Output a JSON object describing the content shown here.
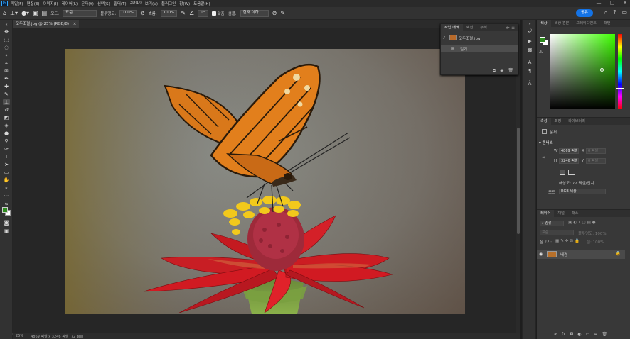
{
  "menubar": {
    "logo": "Ps",
    "items": [
      "파일(F)",
      "편집(E)",
      "이미지(I)",
      "레이어(L)",
      "문자(Y)",
      "선택(S)",
      "필터(T)",
      "3D(D)",
      "보기(V)",
      "플러그인",
      "창(W)",
      "도움말(H)"
    ],
    "controls": [
      "—",
      "▢",
      "✕"
    ]
  },
  "options": {
    "mode_label": "모드:",
    "mode_value": "표준",
    "opacity_label": "불투명도:",
    "opacity_value": "100%",
    "flow_label": "흐름:",
    "flow_value": "100%",
    "angle_value": "0°",
    "smooth_label": "맞춤",
    "sample_label": "샘플:",
    "sample_value": "현재 이하",
    "share": "공유"
  },
  "document": {
    "tab": "모두조절.jpg @ 25% (RGB/8)",
    "close": "×"
  },
  "status": {
    "zoom": "25%",
    "info": "4869 픽셀 x 3246 픽셀 (72 ppi)"
  },
  "history": {
    "tabs": [
      "작업 내역",
      "액션",
      "주석"
    ],
    "source": "모두조절.jpg",
    "step": "열기"
  },
  "color": {
    "tabs": [
      "색상",
      "색상 견본",
      "그레이디언트",
      "패턴"
    ],
    "fg": "#2e8b1e",
    "bg": "#ffffff"
  },
  "properties": {
    "tabs": [
      "속성",
      "조정",
      "라이브러리"
    ],
    "kind": "문서",
    "section": "캔버스",
    "w_label": "W",
    "w_value": "4869 픽셀",
    "h_label": "H",
    "h_value": "3246 픽셀",
    "x_label": "X",
    "y_label": "Y",
    "x_placeholder": "0 픽셀",
    "y_placeholder": "0 픽셀",
    "resolution": "해상도: 72 픽셀/인치",
    "mode_label": "모드",
    "mode_value": "RGB 색상"
  },
  "layers": {
    "tabs": [
      "레이어",
      "채널",
      "패스"
    ],
    "filter": "종류",
    "blend": "표준",
    "opacity": "불투명도: 100%",
    "lock": "잠그기:",
    "fill": "칠: 100%",
    "layer_name": "배경"
  }
}
